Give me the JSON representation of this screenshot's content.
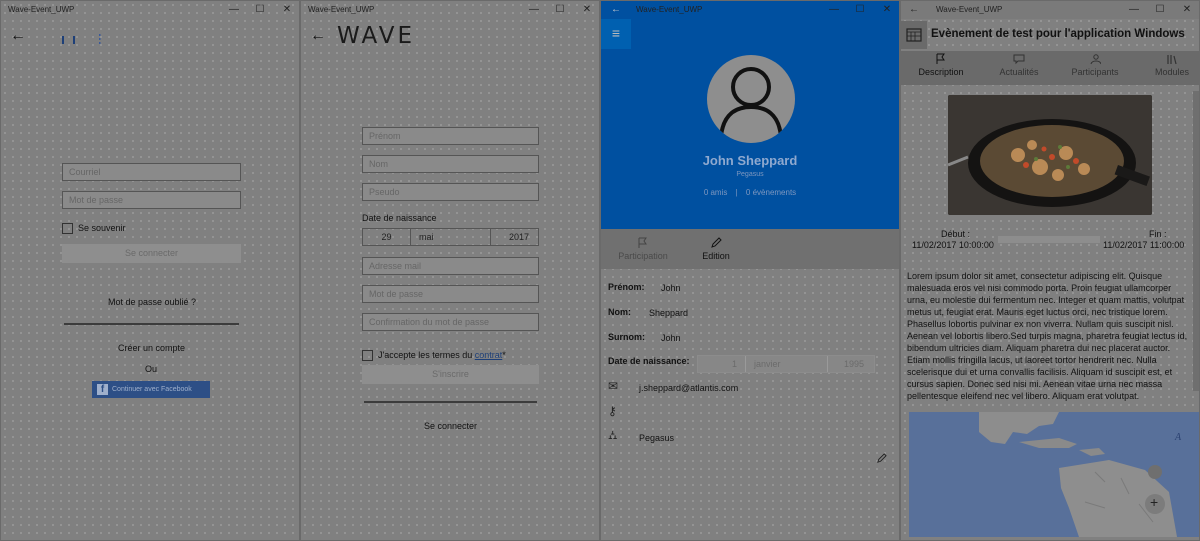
{
  "window_title": "Wave-Event_UWP",
  "controls": {
    "minimize": "—",
    "maximize": "☐",
    "close": "✕"
  },
  "login": {
    "email_placeholder": "Courriel",
    "password_placeholder": "Mot de passe",
    "remember_label": "Se souvenir",
    "connect_button": "Se connecter",
    "forgot_link": "Mot de passe oublié ?",
    "create_account_link": "Créer un compte",
    "or_text": "Ou",
    "facebook_button": "Continuer avec Facebook"
  },
  "register": {
    "logo_text": "WAVE",
    "firstname_placeholder": "Prénom",
    "lastname_placeholder": "Nom",
    "nickname_placeholder": "Pseudo",
    "birthdate_label": "Date de naissance",
    "birth_day": "29",
    "birth_month": "mai",
    "birth_year": "2017",
    "email_placeholder": "Adresse mail",
    "password_placeholder": "Mot de passe",
    "confirm_placeholder": "Confirmation du mot de passe",
    "terms_text": "J'accepte les termes du ",
    "terms_link": "contrat",
    "terms_suffix": "*",
    "register_button": "S'inscrire",
    "login_link": "Se connecter"
  },
  "profile": {
    "name": "John Sheppard",
    "group": "Pegasus",
    "friends": "0 amis",
    "separator": "|",
    "events": "0 évènements",
    "tabs": [
      {
        "label": "Participation",
        "icon": "flag-icon"
      },
      {
        "label": "Edition",
        "icon": "pencil-icon"
      }
    ],
    "firstname_label": "Prénom:",
    "firstname": "John",
    "lastname_label": "Nom:",
    "lastname": "Sheppard",
    "nickname_label": "Surnom:",
    "nickname": "John",
    "birthdate_label": "Date de naissance:",
    "birth_day": "1",
    "birth_month": "janvier",
    "birth_year": "1995",
    "email": "j.sheppard@atlantis.com",
    "group_value": "Pegasus"
  },
  "event": {
    "title": "Evènement de test pour l'application Windows",
    "tabs": [
      {
        "label": "Description",
        "icon": "flag-icon"
      },
      {
        "label": "Actualités",
        "icon": "chat-icon"
      },
      {
        "label": "Participants",
        "icon": "people-icon"
      },
      {
        "label": "Modules",
        "icon": "books-icon"
      }
    ],
    "start_label": "Début :",
    "start_value": "11/02/2017 10:00:00",
    "end_label": "Fin :",
    "end_value": "11/02/2017 11:00:00",
    "description": "Lorem ipsum dolor sit amet, consectetur adipiscing elit. Quisque malesuada eros vel nisi commodo porta. Proin feugiat ullamcorper urna, eu molestie dui fermentum nec. Integer et quam mattis, volutpat metus ut, feugiat erat. Mauris eget luctus orci, nec tristique lorem. Phasellus lobortis pulvinar ex non viverra. Nullam quis suscipit nisl. Aenean vel lobortis libero.Sed turpis magna, pharetra feugiat lectus id, bibendum ultricies diam. Aliquam pharetra dui nec placerat auctor. Etiam mollis fringilla lacus, ut laoreet tortor hendrerit nec. Nulla scelerisque dui et urna convallis facilisis. Aliquam id suscipit est, et cursus sapien. Donec sed nisi mi. Aenean vitae urna nec massa pellentesque eleifend nec vel libero. Aliquam erat volutpat.",
    "map_zoom_in": "+"
  }
}
